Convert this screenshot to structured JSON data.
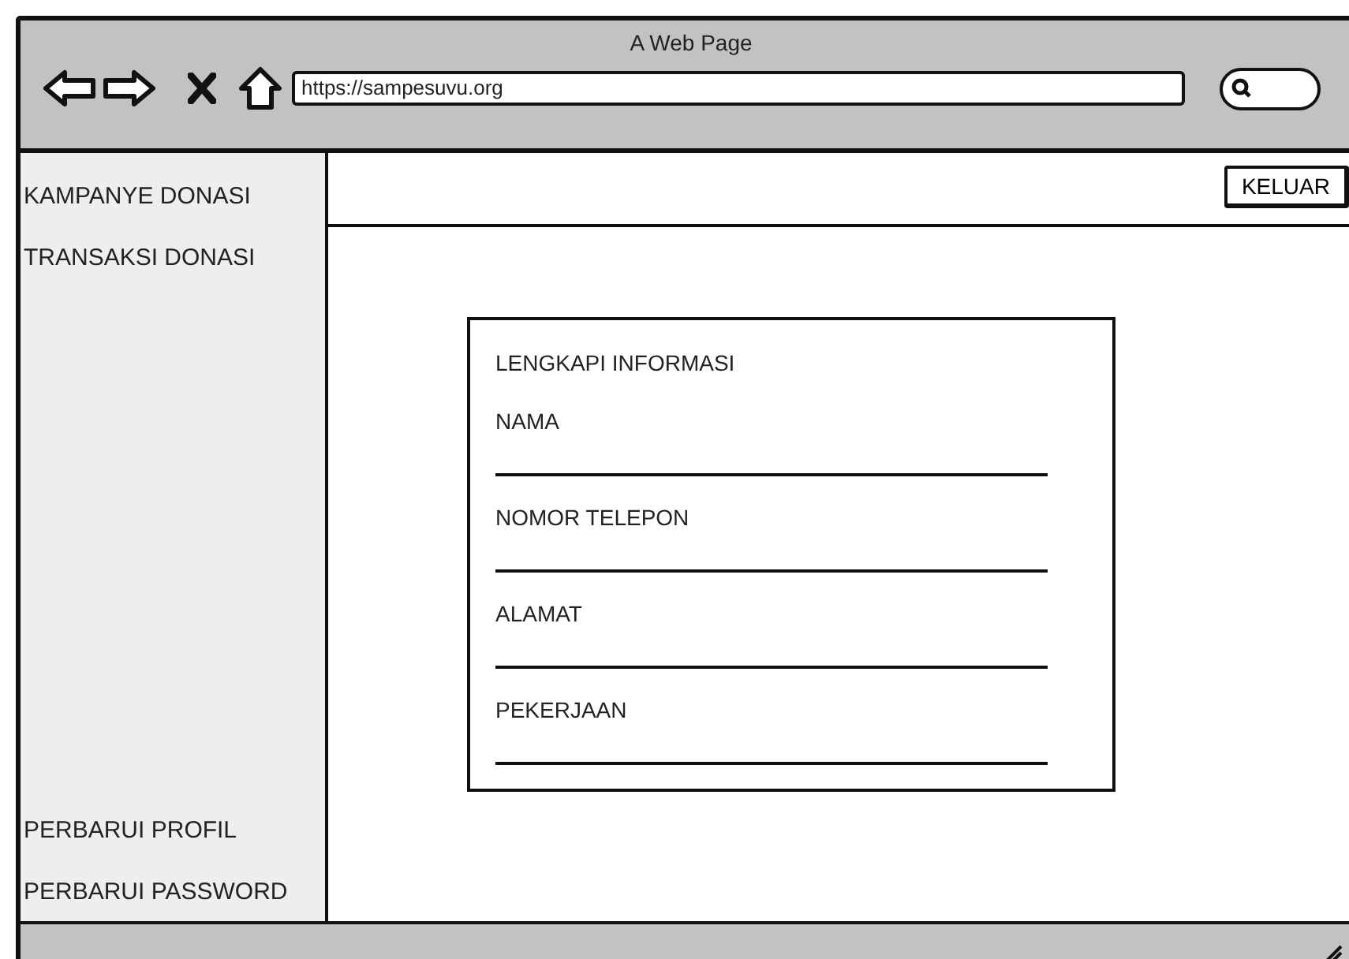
{
  "window": {
    "title": "A Web Page"
  },
  "toolbar": {
    "url": "https://sampesuvu.org"
  },
  "sidebar": {
    "top_items": [
      {
        "label": "KAMPANYE DONASI"
      },
      {
        "label": "TRANSAKSI DONASI"
      }
    ],
    "bottom_items": [
      {
        "label": "PERBARUI PROFIL"
      },
      {
        "label": "PERBARUI PASSWORD"
      }
    ]
  },
  "header": {
    "logout_button": "KELUAR"
  },
  "form": {
    "title": "LENGKAPI INFORMASI",
    "fields": [
      {
        "label": "NAMA"
      },
      {
        "label": "NOMOR TELEPON"
      },
      {
        "label": "ALAMAT"
      },
      {
        "label": "PEKERJAAN"
      }
    ]
  }
}
